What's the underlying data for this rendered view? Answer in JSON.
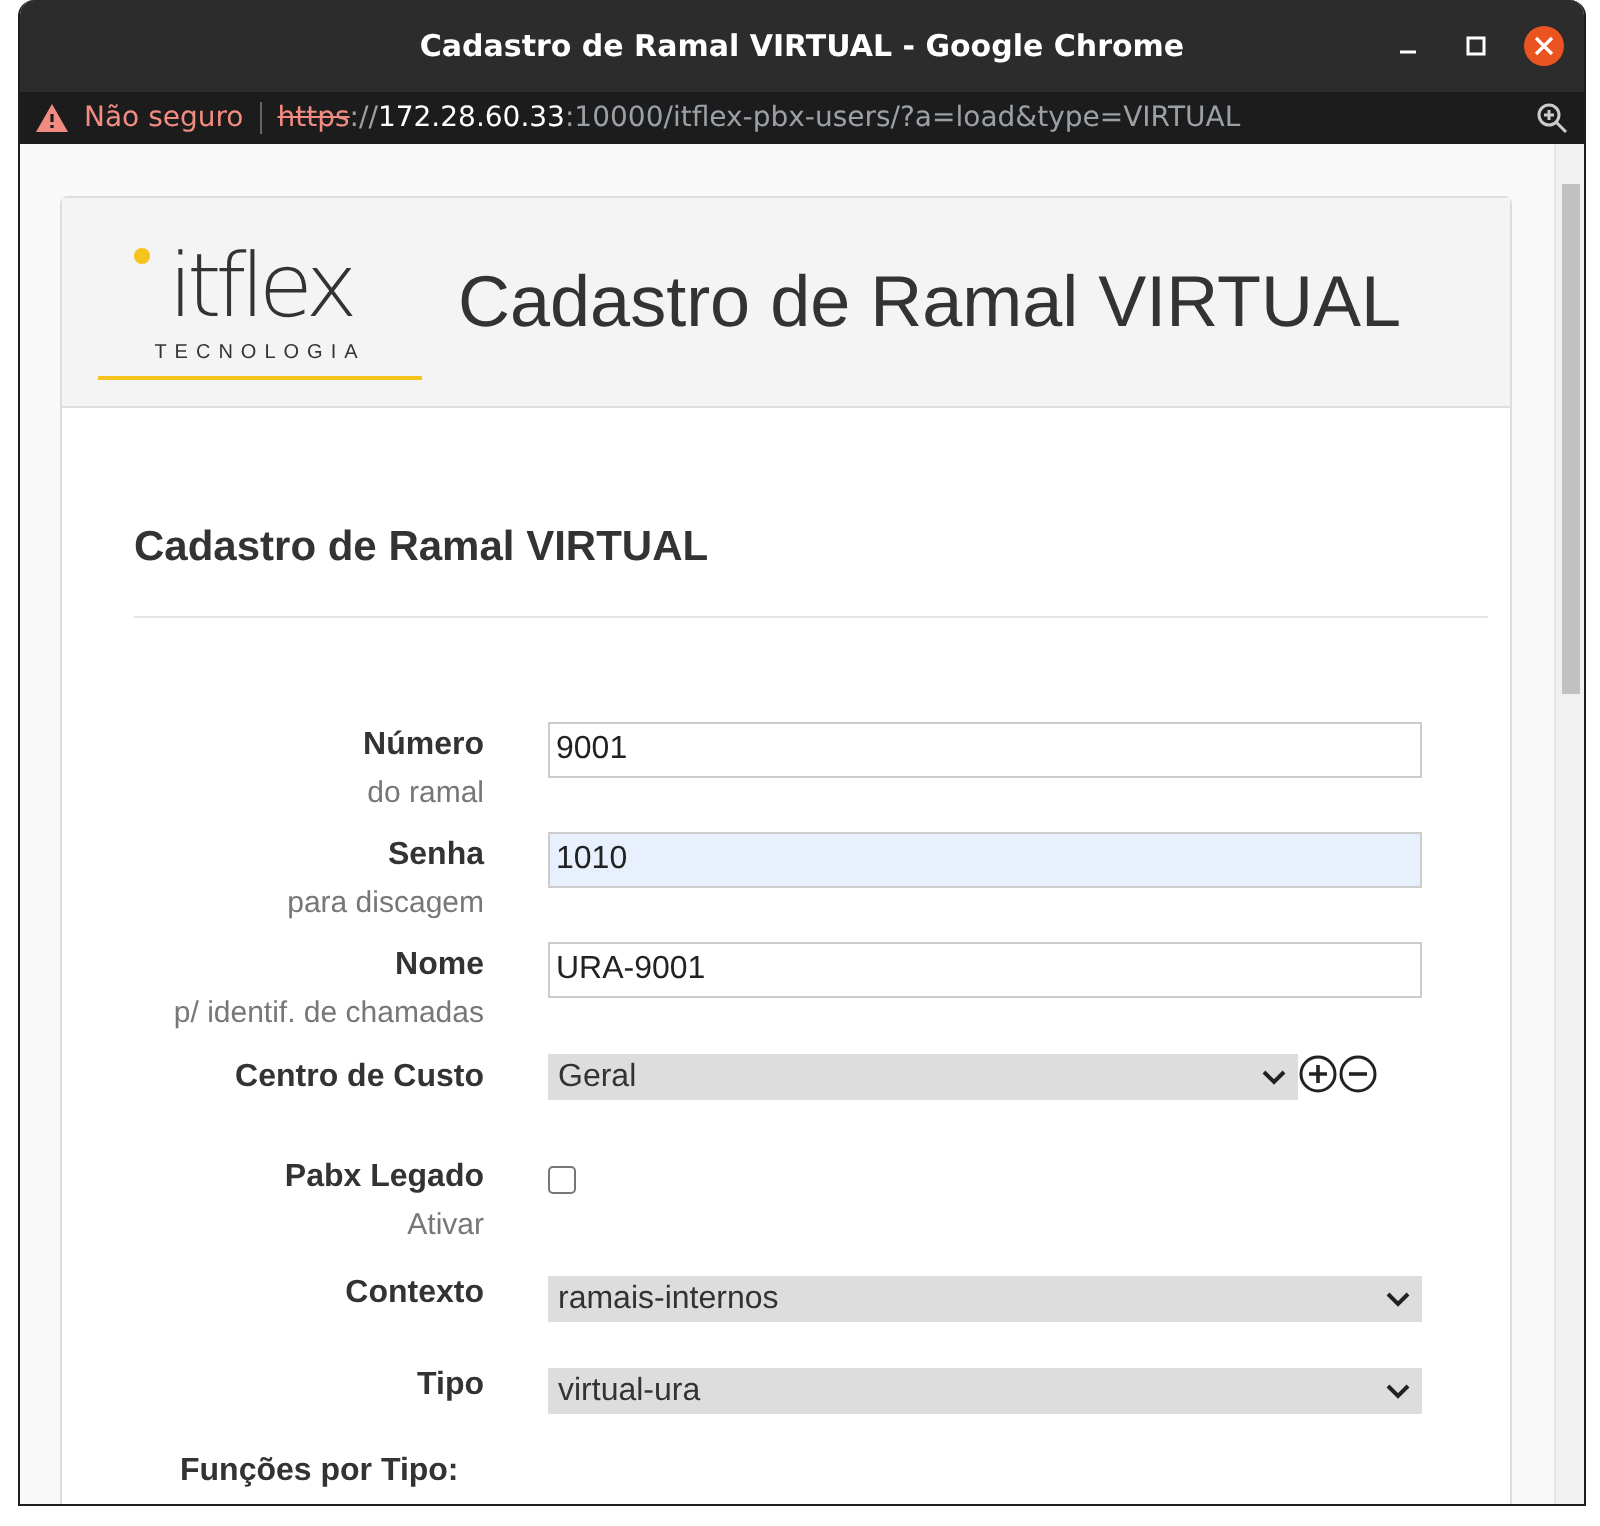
{
  "window": {
    "title": "Cadastro de Ramal VIRTUAL - Google Chrome"
  },
  "address_bar": {
    "security": "Não seguro",
    "scheme": "https",
    "separator": "://",
    "host": "172.28.60.33",
    "path": ":10000/itflex-pbx-users/?a=load&type=VIRTUAL"
  },
  "header": {
    "logo": {
      "wordmark": "itflex",
      "tagline": "TECNOLOGIA"
    },
    "title": "Cadastro de Ramal VIRTUAL"
  },
  "section_title": "Cadastro de Ramal VIRTUAL",
  "fields": [
    {
      "kind": "text",
      "label": "Número",
      "hint": "do ramal",
      "value": "9001",
      "autofilled": false
    },
    {
      "kind": "text",
      "label": "Senha",
      "hint": "para discagem",
      "value": "1010",
      "autofilled": true
    },
    {
      "kind": "text",
      "label": "Nome",
      "hint": "p/ identif. de chamadas",
      "value": "URA-9001",
      "autofilled": false
    },
    {
      "kind": "select-addremove",
      "label": "Centro de Custo",
      "value": "Geral"
    },
    {
      "kind": "checkbox",
      "label": "Pabx Legado",
      "hint": "Ativar",
      "checked": false
    },
    {
      "kind": "select",
      "label": "Contexto",
      "value": "ramais-internos"
    },
    {
      "kind": "select",
      "label": "Tipo",
      "value": "virtual-ura"
    },
    {
      "kind": "heading",
      "label": "Funções por Tipo:"
    }
  ]
}
